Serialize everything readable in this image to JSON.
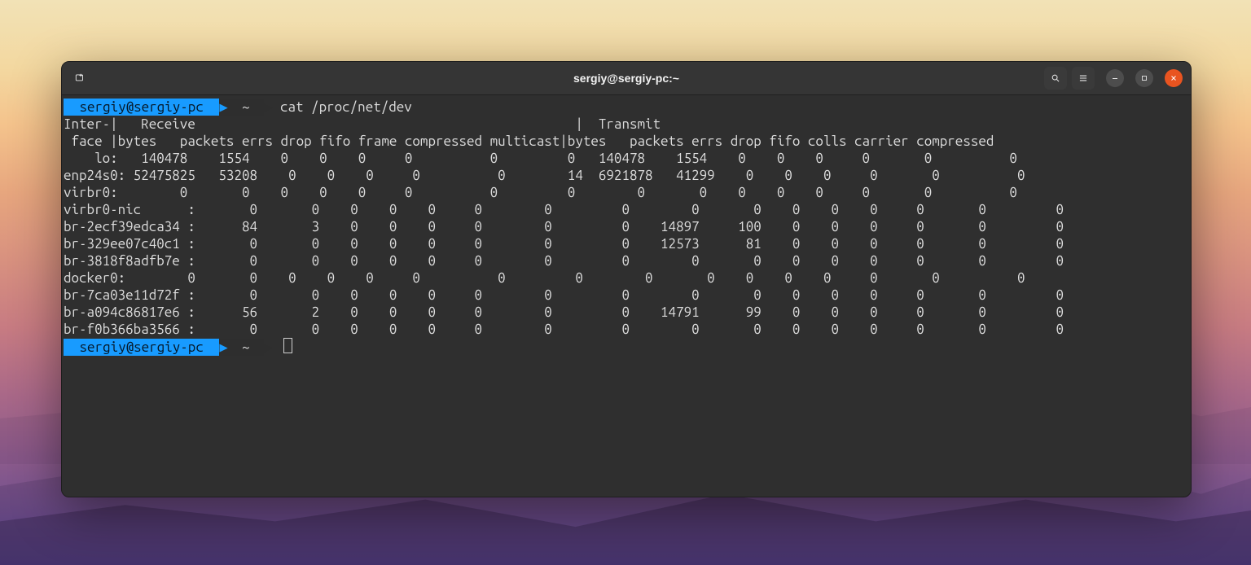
{
  "window": {
    "title": "sergiy@sergiy-pc:~"
  },
  "prompt": {
    "user_host": "sergiy@sergiy-pc",
    "cwd": "~"
  },
  "command": "cat /proc/net/dev",
  "headers": {
    "line1_left": "Inter-|   Receive",
    "line1_right": "|  Transmit",
    "rx": [
      "bytes",
      "packets",
      "errs",
      "drop",
      "fifo",
      "frame",
      "compressed",
      "multicast"
    ],
    "tx": [
      "bytes",
      "packets",
      "errs",
      "drop",
      "fifo",
      "colls",
      "carrier",
      "compressed"
    ],
    "face_label": " face "
  },
  "interfaces": [
    {
      "name": "lo",
      "rx": [
        140478,
        1554,
        0,
        0,
        0,
        0,
        0,
        0
      ],
      "tx": [
        140478,
        1554,
        0,
        0,
        0,
        0,
        0,
        0
      ]
    },
    {
      "name": "enp24s0",
      "rx": [
        52475825,
        53208,
        0,
        0,
        0,
        0,
        0,
        14
      ],
      "tx": [
        6921878,
        41299,
        0,
        0,
        0,
        0,
        0,
        0
      ]
    },
    {
      "name": "virbr0",
      "rx": [
        0,
        0,
        0,
        0,
        0,
        0,
        0,
        0
      ],
      "tx": [
        0,
        0,
        0,
        0,
        0,
        0,
        0,
        0
      ]
    },
    {
      "name": "virbr0-nic",
      "rx": [
        0,
        0,
        0,
        0,
        0,
        0,
        0,
        0
      ],
      "tx": [
        0,
        0,
        0,
        0,
        0,
        0,
        0,
        0
      ]
    },
    {
      "name": "br-2ecf39edca34",
      "rx": [
        84,
        3,
        0,
        0,
        0,
        0,
        0,
        0
      ],
      "tx": [
        14897,
        100,
        0,
        0,
        0,
        0,
        0,
        0
      ]
    },
    {
      "name": "br-329ee07c40c1",
      "rx": [
        0,
        0,
        0,
        0,
        0,
        0,
        0,
        0
      ],
      "tx": [
        12573,
        81,
        0,
        0,
        0,
        0,
        0,
        0
      ]
    },
    {
      "name": "br-3818f8adfb7e",
      "rx": [
        0,
        0,
        0,
        0,
        0,
        0,
        0,
        0
      ],
      "tx": [
        0,
        0,
        0,
        0,
        0,
        0,
        0,
        0
      ]
    },
    {
      "name": "docker0",
      "rx": [
        0,
        0,
        0,
        0,
        0,
        0,
        0,
        0
      ],
      "tx": [
        0,
        0,
        0,
        0,
        0,
        0,
        0,
        0
      ]
    },
    {
      "name": "br-7ca03e11d72f",
      "rx": [
        0,
        0,
        0,
        0,
        0,
        0,
        0,
        0
      ],
      "tx": [
        0,
        0,
        0,
        0,
        0,
        0,
        0,
        0
      ]
    },
    {
      "name": "br-a094c86817e6",
      "rx": [
        56,
        2,
        0,
        0,
        0,
        0,
        0,
        0
      ],
      "tx": [
        14791,
        99,
        0,
        0,
        0,
        0,
        0,
        0
      ]
    },
    {
      "name": "br-f0b366ba3566",
      "rx": [
        0,
        0,
        0,
        0,
        0,
        0,
        0,
        0
      ],
      "tx": [
        0,
        0,
        0,
        0,
        0,
        0,
        0,
        0
      ]
    }
  ],
  "chart_data": {
    "type": "table",
    "title": "/proc/net/dev",
    "columns": [
      "iface",
      "rx_bytes",
      "rx_packets",
      "rx_errs",
      "rx_drop",
      "rx_fifo",
      "rx_frame",
      "rx_compressed",
      "rx_multicast",
      "tx_bytes",
      "tx_packets",
      "tx_errs",
      "tx_drop",
      "tx_fifo",
      "tx_colls",
      "tx_carrier",
      "tx_compressed"
    ],
    "rows": [
      [
        "lo",
        140478,
        1554,
        0,
        0,
        0,
        0,
        0,
        0,
        140478,
        1554,
        0,
        0,
        0,
        0,
        0,
        0
      ],
      [
        "enp24s0",
        52475825,
        53208,
        0,
        0,
        0,
        0,
        0,
        14,
        6921878,
        41299,
        0,
        0,
        0,
        0,
        0,
        0
      ],
      [
        "virbr0",
        0,
        0,
        0,
        0,
        0,
        0,
        0,
        0,
        0,
        0,
        0,
        0,
        0,
        0,
        0,
        0
      ],
      [
        "virbr0-nic",
        0,
        0,
        0,
        0,
        0,
        0,
        0,
        0,
        0,
        0,
        0,
        0,
        0,
        0,
        0,
        0
      ],
      [
        "br-2ecf39edca34",
        84,
        3,
        0,
        0,
        0,
        0,
        0,
        0,
        14897,
        100,
        0,
        0,
        0,
        0,
        0,
        0
      ],
      [
        "br-329ee07c40c1",
        0,
        0,
        0,
        0,
        0,
        0,
        0,
        0,
        12573,
        81,
        0,
        0,
        0,
        0,
        0,
        0
      ],
      [
        "br-3818f8adfb7e",
        0,
        0,
        0,
        0,
        0,
        0,
        0,
        0,
        0,
        0,
        0,
        0,
        0,
        0,
        0,
        0
      ],
      [
        "docker0",
        0,
        0,
        0,
        0,
        0,
        0,
        0,
        0,
        0,
        0,
        0,
        0,
        0,
        0,
        0,
        0
      ],
      [
        "br-7ca03e11d72f",
        0,
        0,
        0,
        0,
        0,
        0,
        0,
        0,
        0,
        0,
        0,
        0,
        0,
        0,
        0,
        0
      ],
      [
        "br-a094c86817e6",
        56,
        2,
        0,
        0,
        0,
        0,
        0,
        0,
        14791,
        99,
        0,
        0,
        0,
        0,
        0,
        0
      ],
      [
        "br-f0b366ba3566",
        0,
        0,
        0,
        0,
        0,
        0,
        0,
        0,
        0,
        0,
        0,
        0,
        0,
        0,
        0,
        0
      ]
    ]
  }
}
